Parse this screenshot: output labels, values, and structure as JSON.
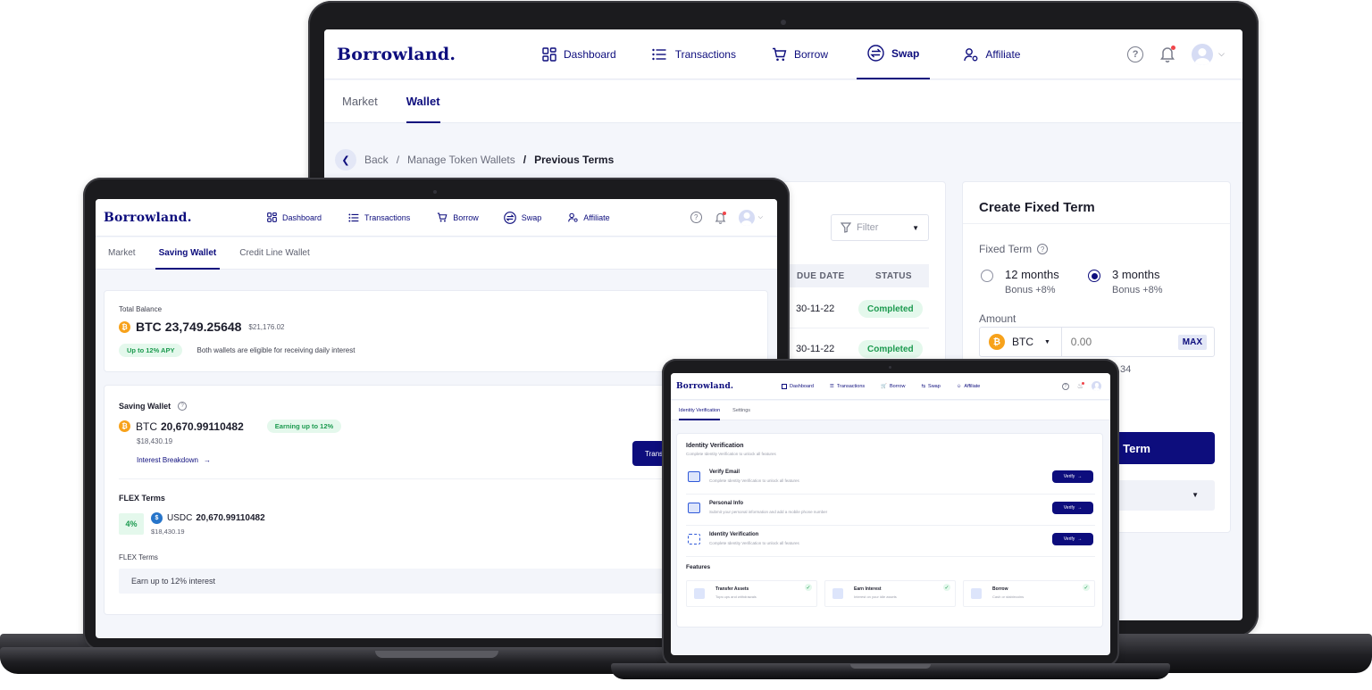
{
  "brand": {
    "logo": "Borrowland.",
    "navy": "#0d0d7d",
    "green": "#1c9a4f",
    "btc": "#f7a21b",
    "usdc": "#2775ca"
  },
  "nav": {
    "dashboard": "Dashboard",
    "transactions": "Transactions",
    "borrow": "Borrow",
    "swap": "Swap",
    "affiliate": "Affiliate"
  },
  "desktop": {
    "tabs": {
      "market": "Market",
      "wallet": "Wallet"
    },
    "breadcrumb": {
      "back": "Back",
      "sep1": "/",
      "manage": "Manage Token Wallets",
      "sep2": "/",
      "current": "Previous Terms"
    },
    "table": {
      "filter": "Filter",
      "headers": {
        "due": "DUE DATE",
        "status": "STATUS"
      },
      "rows": [
        {
          "due": "30-11-22",
          "status": "Completed"
        },
        {
          "due": "30-11-22",
          "status": "Completed"
        }
      ]
    },
    "fixed_term": {
      "title": "Create Fixed Term",
      "label": "Fixed Term",
      "options": [
        {
          "label": "12 months",
          "bonus": "Bonus +8%",
          "selected": false
        },
        {
          "label": "3 months",
          "bonus": "Bonus +8%",
          "selected": true
        }
      ],
      "amount_label": "Amount",
      "asset": "BTC",
      "amount_placeholder": "0.00",
      "max": "MAX",
      "partial_balance": "34",
      "cta_partial": "Term"
    }
  },
  "laptop": {
    "tabs": {
      "market": "Market",
      "saving": "Saving Wallet",
      "credit": "Credit Line Wallet"
    },
    "total": {
      "label": "Total Balance",
      "asset": "BTC",
      "amount": "23,749.25648",
      "usd": "$21,176.02",
      "apy": "Up to 12% APY",
      "note": "Both wallets are eligible for receiving daily interest"
    },
    "saving": {
      "title": "Saving Wallet",
      "asset": "BTC",
      "amount": "20,670.99110482",
      "badge": "Earning up to 12%",
      "usd": "$18,430.19",
      "link": "Interest Breakdown",
      "button_partial": "Trans"
    },
    "flex": {
      "title": "FLEX Terms",
      "rate": "4%",
      "asset": "USDC",
      "amount": "20,670.99110482",
      "usd": "$18,430.19",
      "sub_title": "FLEX Terms",
      "box": "Earn up to 12% interest"
    }
  },
  "tablet": {
    "tabs": {
      "identity": "Identity Verification",
      "settings": "Settings"
    },
    "section_title": "Identity Verification",
    "section_sub": "Complete Identity Verification to unlock all features",
    "items": [
      {
        "title": "Verify Email",
        "sub": "Complete Identity Verification to unlock all features",
        "button": "Verify"
      },
      {
        "title": "Personal Info",
        "sub": "Submit your personal information and add a mobile phone number",
        "button": "Verify"
      },
      {
        "title": "Identity Verification",
        "sub": "Complete Identity Verification to unlock all features",
        "button": "Verify"
      }
    ],
    "features_title": "Features",
    "features": [
      {
        "title": "Transfer Assets",
        "sub": "Tops ups and withdrawals"
      },
      {
        "title": "Earn Interest",
        "sub": "Interest on your idle assets"
      },
      {
        "title": "Borrow",
        "sub": "Cash or stablecoins"
      }
    ]
  }
}
